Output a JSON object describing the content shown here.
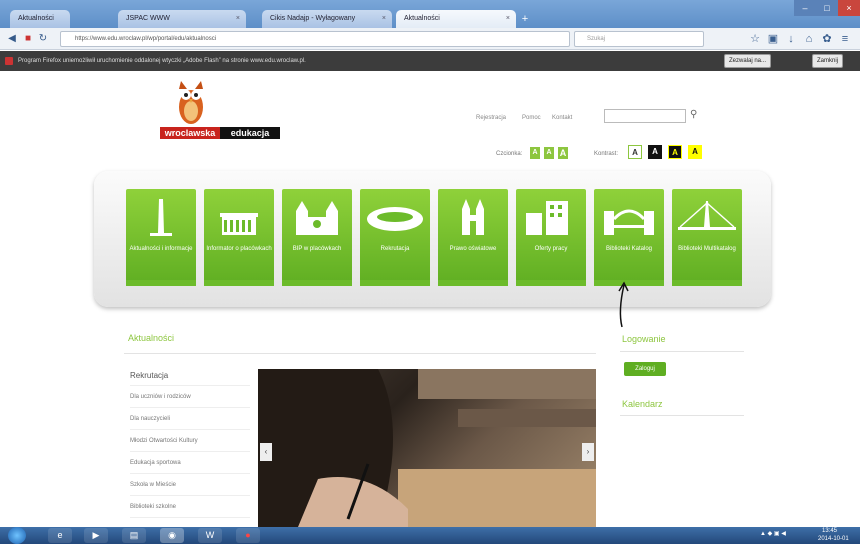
{
  "browser": {
    "tabs": [
      {
        "label": "Aktualności",
        "active": false
      },
      {
        "label": "JSPAC WWW",
        "active": false
      },
      {
        "label": "Cikis Nadajp - Wyłagowany",
        "active": false
      },
      {
        "label": "Aktualności",
        "active": true
      }
    ],
    "new_tab": "+",
    "close": "×",
    "url": "https://www.edu.wroclaw.pl/wp/portal/edu/aktualnosci",
    "search_placeholder": "Szukaj",
    "notice_text": "Program Firefox uniemożliwił uruchomienie oddalonej wtyczki „Adobe Flash” na stronie www.edu.wroclaw.pl.",
    "notice_allow": "Zezwalaj na...",
    "notice_close": "Zamknij"
  },
  "site": {
    "logo_red": "wroclawska",
    "logo_black": "edukacja",
    "top_links": [
      "Rejestracja",
      "Pomoc",
      "Kontakt"
    ],
    "font_label": "Czcionka:",
    "font_sizes": [
      "A",
      "A",
      "A"
    ],
    "contrast_label": "Kontrast:",
    "contrast_options": [
      "A",
      "A",
      "A",
      "A"
    ],
    "menu": [
      {
        "label": "Aktualności i informacje",
        "icon": "obelisk-icon"
      },
      {
        "label": "Informator o placówkach",
        "icon": "building-icon"
      },
      {
        "label": "BIP w placówkach",
        "icon": "cathedral-icon"
      },
      {
        "label": "Rekrutacja",
        "icon": "stadium-icon"
      },
      {
        "label": "Prawo oświatowe",
        "icon": "church-tower-icon"
      },
      {
        "label": "Oferty pracy",
        "icon": "office-icon"
      },
      {
        "label": "Biblioteki Katalog",
        "icon": "bridge-icon"
      },
      {
        "label": "Biblioteki Multikatalog",
        "icon": "suspension-bridge-icon"
      }
    ],
    "news_heading": "Aktualności",
    "side_menu": [
      "Rekrutacja",
      "Dla uczniów i rodziców",
      "Dla nauczycieli",
      "Młodzi Otwartości Kultury",
      "Edukacja sportowa",
      "Szkoła w Mieście",
      "Biblioteki szkolne"
    ],
    "login_heading": "Logowanie",
    "login_button": "Zaloguj",
    "calendar_heading": "Kalendarz",
    "slider_prev": "‹",
    "slider_next": "›"
  },
  "taskbar": {
    "time": "13:45",
    "date": "2014-10-01"
  },
  "colors": {
    "accent_green": "#8dc63f",
    "tile_green": "#5fae22",
    "brand_red": "#c8231d"
  }
}
